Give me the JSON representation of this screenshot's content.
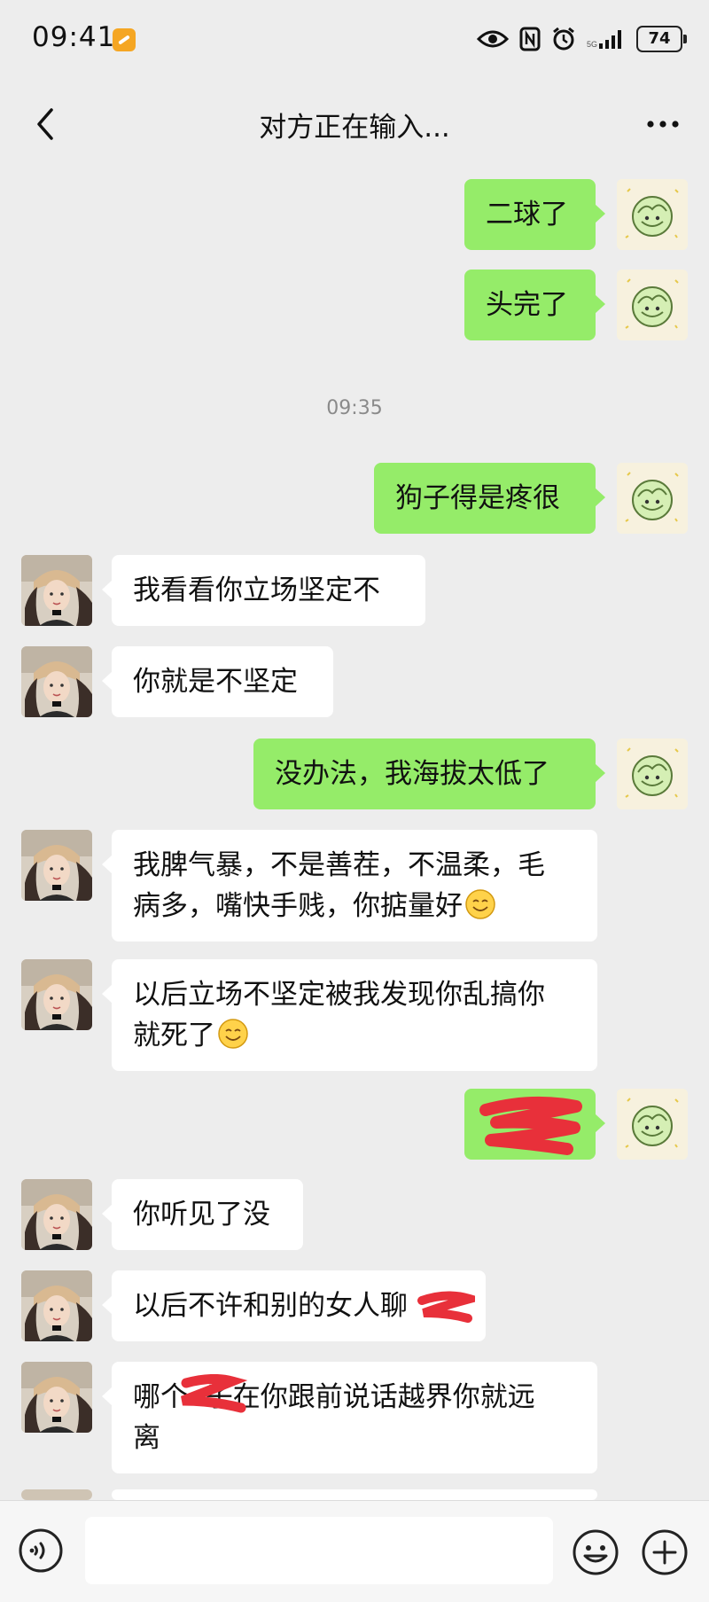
{
  "status_bar": {
    "time": "09:41",
    "battery": "74",
    "icons": [
      "eye-icon",
      "nfc-icon",
      "alarm-icon",
      "signal-icon",
      "battery-icon"
    ]
  },
  "header": {
    "title": "对方正在输入...",
    "back_icon": "chevron-left-icon",
    "more_icon": "more-dots-icon"
  },
  "messages": [
    {
      "from": "self",
      "text": "二球了"
    },
    {
      "from": "self",
      "text": "头完了"
    },
    {
      "type": "timestamp",
      "text": "09:35"
    },
    {
      "from": "self",
      "text": "狗子得是疼很"
    },
    {
      "from": "other",
      "text": "我看看你立场坚定不"
    },
    {
      "from": "other",
      "text": "你就是不坚定"
    },
    {
      "from": "self",
      "text": "没办法，我海拔太低了"
    },
    {
      "from": "other",
      "line1": "我脾气暴，不是善茬，不温柔，毛",
      "line2": "病多，嘴快手贱，你掂量好",
      "emoji": "smile-emoji"
    },
    {
      "from": "other",
      "line1": "以后立场不坚定被我发现你乱搞你",
      "line2": "就死了",
      "emoji": "smile-emoji"
    },
    {
      "from": "self",
      "text": "",
      "redacted": true
    },
    {
      "from": "other",
      "text": "你听见了没"
    },
    {
      "from": "other",
      "text": "以后不许和别的女人聊",
      "redacted_part": true
    },
    {
      "from": "other",
      "line1": "哪个  子在你跟前说话越界你就远",
      "line2": "离",
      "redacted_part": true
    }
  ],
  "input_bar": {
    "placeholder": "",
    "value": "",
    "voice_icon": "voice-icon",
    "emoji_icon": "emoji-icon",
    "plus_icon": "plus-icon"
  },
  "colors": {
    "background": "#ededed",
    "outgoing_bubble": "#95ec69",
    "incoming_bubble": "#ffffff",
    "redaction": "#e8303a"
  }
}
